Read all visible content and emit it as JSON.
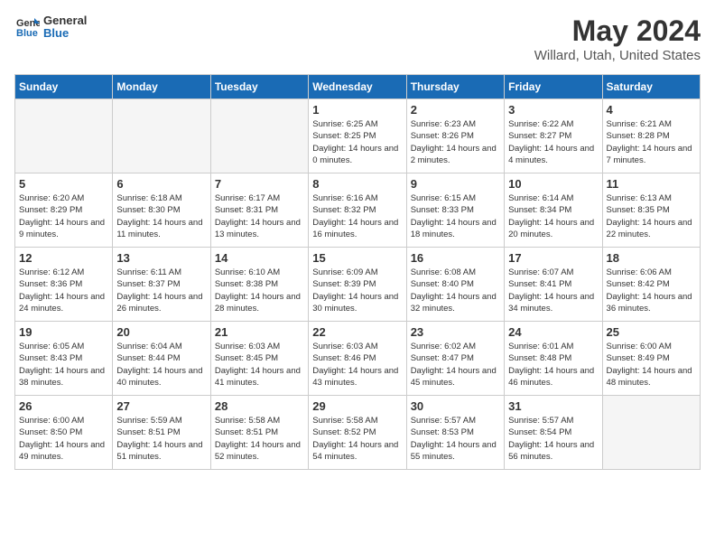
{
  "header": {
    "logo_line1": "General",
    "logo_line2": "Blue",
    "month": "May 2024",
    "location": "Willard, Utah, United States"
  },
  "days_of_week": [
    "Sunday",
    "Monday",
    "Tuesday",
    "Wednesday",
    "Thursday",
    "Friday",
    "Saturday"
  ],
  "weeks": [
    [
      {
        "day": "",
        "empty": true
      },
      {
        "day": "",
        "empty": true
      },
      {
        "day": "",
        "empty": true
      },
      {
        "day": "1",
        "sunrise": "Sunrise: 6:25 AM",
        "sunset": "Sunset: 8:25 PM",
        "daylight": "Daylight: 14 hours and 0 minutes."
      },
      {
        "day": "2",
        "sunrise": "Sunrise: 6:23 AM",
        "sunset": "Sunset: 8:26 PM",
        "daylight": "Daylight: 14 hours and 2 minutes."
      },
      {
        "day": "3",
        "sunrise": "Sunrise: 6:22 AM",
        "sunset": "Sunset: 8:27 PM",
        "daylight": "Daylight: 14 hours and 4 minutes."
      },
      {
        "day": "4",
        "sunrise": "Sunrise: 6:21 AM",
        "sunset": "Sunset: 8:28 PM",
        "daylight": "Daylight: 14 hours and 7 minutes."
      }
    ],
    [
      {
        "day": "5",
        "sunrise": "Sunrise: 6:20 AM",
        "sunset": "Sunset: 8:29 PM",
        "daylight": "Daylight: 14 hours and 9 minutes."
      },
      {
        "day": "6",
        "sunrise": "Sunrise: 6:18 AM",
        "sunset": "Sunset: 8:30 PM",
        "daylight": "Daylight: 14 hours and 11 minutes."
      },
      {
        "day": "7",
        "sunrise": "Sunrise: 6:17 AM",
        "sunset": "Sunset: 8:31 PM",
        "daylight": "Daylight: 14 hours and 13 minutes."
      },
      {
        "day": "8",
        "sunrise": "Sunrise: 6:16 AM",
        "sunset": "Sunset: 8:32 PM",
        "daylight": "Daylight: 14 hours and 16 minutes."
      },
      {
        "day": "9",
        "sunrise": "Sunrise: 6:15 AM",
        "sunset": "Sunset: 8:33 PM",
        "daylight": "Daylight: 14 hours and 18 minutes."
      },
      {
        "day": "10",
        "sunrise": "Sunrise: 6:14 AM",
        "sunset": "Sunset: 8:34 PM",
        "daylight": "Daylight: 14 hours and 20 minutes."
      },
      {
        "day": "11",
        "sunrise": "Sunrise: 6:13 AM",
        "sunset": "Sunset: 8:35 PM",
        "daylight": "Daylight: 14 hours and 22 minutes."
      }
    ],
    [
      {
        "day": "12",
        "sunrise": "Sunrise: 6:12 AM",
        "sunset": "Sunset: 8:36 PM",
        "daylight": "Daylight: 14 hours and 24 minutes."
      },
      {
        "day": "13",
        "sunrise": "Sunrise: 6:11 AM",
        "sunset": "Sunset: 8:37 PM",
        "daylight": "Daylight: 14 hours and 26 minutes."
      },
      {
        "day": "14",
        "sunrise": "Sunrise: 6:10 AM",
        "sunset": "Sunset: 8:38 PM",
        "daylight": "Daylight: 14 hours and 28 minutes."
      },
      {
        "day": "15",
        "sunrise": "Sunrise: 6:09 AM",
        "sunset": "Sunset: 8:39 PM",
        "daylight": "Daylight: 14 hours and 30 minutes."
      },
      {
        "day": "16",
        "sunrise": "Sunrise: 6:08 AM",
        "sunset": "Sunset: 8:40 PM",
        "daylight": "Daylight: 14 hours and 32 minutes."
      },
      {
        "day": "17",
        "sunrise": "Sunrise: 6:07 AM",
        "sunset": "Sunset: 8:41 PM",
        "daylight": "Daylight: 14 hours and 34 minutes."
      },
      {
        "day": "18",
        "sunrise": "Sunrise: 6:06 AM",
        "sunset": "Sunset: 8:42 PM",
        "daylight": "Daylight: 14 hours and 36 minutes."
      }
    ],
    [
      {
        "day": "19",
        "sunrise": "Sunrise: 6:05 AM",
        "sunset": "Sunset: 8:43 PM",
        "daylight": "Daylight: 14 hours and 38 minutes."
      },
      {
        "day": "20",
        "sunrise": "Sunrise: 6:04 AM",
        "sunset": "Sunset: 8:44 PM",
        "daylight": "Daylight: 14 hours and 40 minutes."
      },
      {
        "day": "21",
        "sunrise": "Sunrise: 6:03 AM",
        "sunset": "Sunset: 8:45 PM",
        "daylight": "Daylight: 14 hours and 41 minutes."
      },
      {
        "day": "22",
        "sunrise": "Sunrise: 6:03 AM",
        "sunset": "Sunset: 8:46 PM",
        "daylight": "Daylight: 14 hours and 43 minutes."
      },
      {
        "day": "23",
        "sunrise": "Sunrise: 6:02 AM",
        "sunset": "Sunset: 8:47 PM",
        "daylight": "Daylight: 14 hours and 45 minutes."
      },
      {
        "day": "24",
        "sunrise": "Sunrise: 6:01 AM",
        "sunset": "Sunset: 8:48 PM",
        "daylight": "Daylight: 14 hours and 46 minutes."
      },
      {
        "day": "25",
        "sunrise": "Sunrise: 6:00 AM",
        "sunset": "Sunset: 8:49 PM",
        "daylight": "Daylight: 14 hours and 48 minutes."
      }
    ],
    [
      {
        "day": "26",
        "sunrise": "Sunrise: 6:00 AM",
        "sunset": "Sunset: 8:50 PM",
        "daylight": "Daylight: 14 hours and 49 minutes."
      },
      {
        "day": "27",
        "sunrise": "Sunrise: 5:59 AM",
        "sunset": "Sunset: 8:51 PM",
        "daylight": "Daylight: 14 hours and 51 minutes."
      },
      {
        "day": "28",
        "sunrise": "Sunrise: 5:58 AM",
        "sunset": "Sunset: 8:51 PM",
        "daylight": "Daylight: 14 hours and 52 minutes."
      },
      {
        "day": "29",
        "sunrise": "Sunrise: 5:58 AM",
        "sunset": "Sunset: 8:52 PM",
        "daylight": "Daylight: 14 hours and 54 minutes."
      },
      {
        "day": "30",
        "sunrise": "Sunrise: 5:57 AM",
        "sunset": "Sunset: 8:53 PM",
        "daylight": "Daylight: 14 hours and 55 minutes."
      },
      {
        "day": "31",
        "sunrise": "Sunrise: 5:57 AM",
        "sunset": "Sunset: 8:54 PM",
        "daylight": "Daylight: 14 hours and 56 minutes."
      },
      {
        "day": "",
        "empty": true
      }
    ]
  ]
}
